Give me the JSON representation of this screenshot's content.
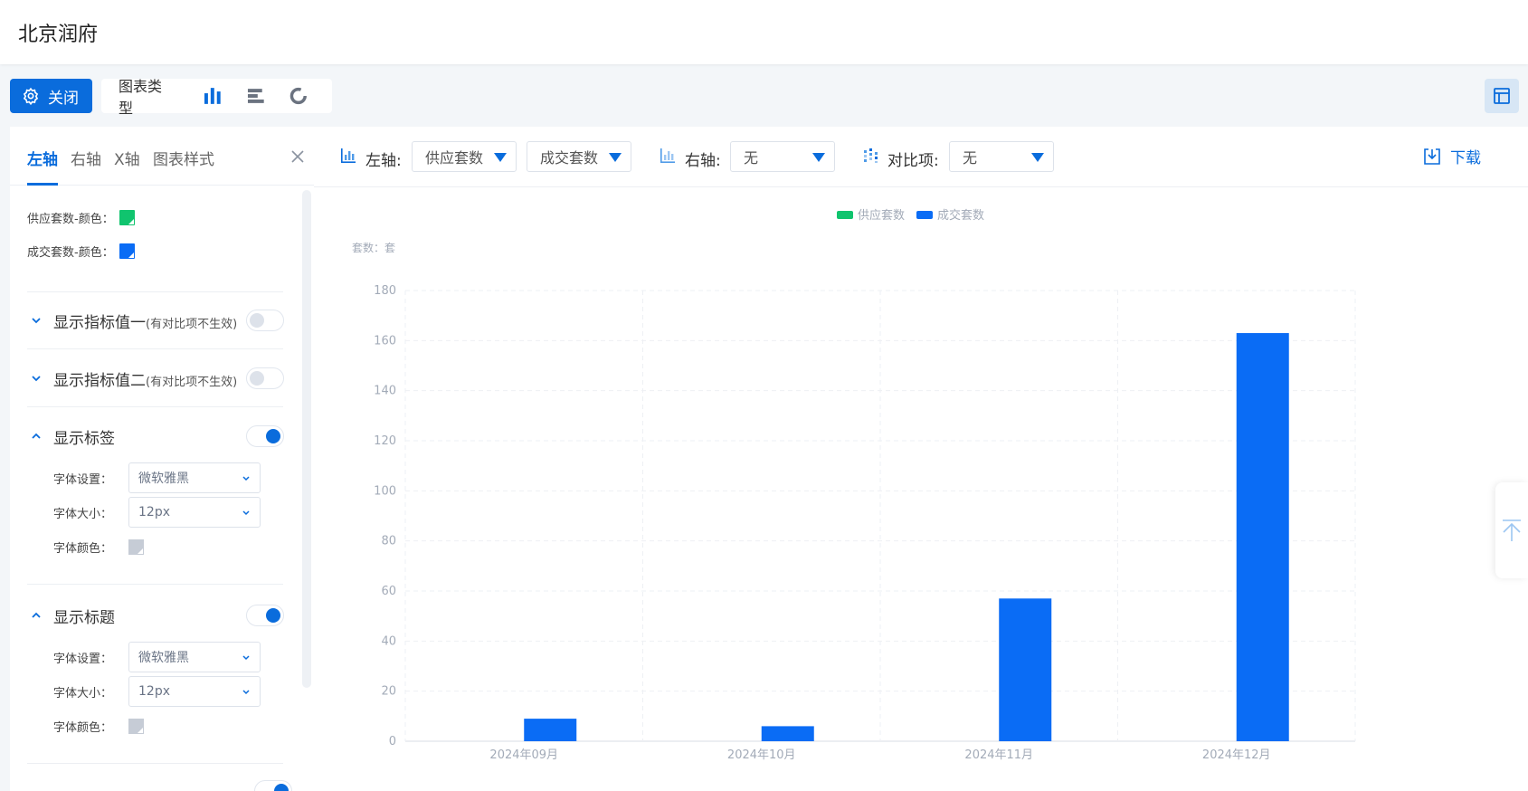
{
  "app": {
    "title": "北京润府"
  },
  "toolbar": {
    "close_label": "关闭",
    "chart_type_label": "图表类型"
  },
  "panel": {
    "tabs": [
      "左轴",
      "右轴",
      "X轴",
      "图表样式"
    ],
    "active_tab": 0,
    "colors": [
      {
        "label": "供应套数-颜色：",
        "color": "#10c46e"
      },
      {
        "label": "成交套数-颜色：",
        "color": "#0a6cf5"
      }
    ],
    "sections": {
      "metric1": {
        "title": "显示指标值一",
        "note": "(有对比项不生效)",
        "enabled": false,
        "expanded": false
      },
      "metric2": {
        "title": "显示指标值二",
        "note": "(有对比项不生效)",
        "enabled": false,
        "expanded": false
      },
      "labels": {
        "title": "显示标签",
        "enabled": true,
        "expanded": true,
        "font_label": "字体设置：",
        "font_value": "微软雅黑",
        "size_label": "字体大小：",
        "size_value": "12px",
        "color_label": "字体颜色："
      },
      "titles": {
        "title": "显示标题",
        "enabled": true,
        "expanded": true,
        "font_label": "字体设置：",
        "font_value": "微软雅黑",
        "size_label": "字体大小：",
        "size_value": "12px",
        "color_label": "字体颜色："
      }
    }
  },
  "axisbar": {
    "left_label": "左轴:",
    "left_values": [
      "供应套数",
      "成交套数"
    ],
    "right_label": "右轴:",
    "right_value": "无",
    "compare_label": "对比项:",
    "compare_value": "无",
    "download_label": "下载"
  },
  "chart_data": {
    "type": "bar",
    "categories": [
      "2024年09月",
      "2024年10月",
      "2024年11月",
      "2024年12月"
    ],
    "series": [
      {
        "name": "供应套数",
        "color": "#10c46e",
        "values": [
          0,
          0,
          0,
          0
        ]
      },
      {
        "name": "成交套数",
        "color": "#0a6cf5",
        "values": [
          9,
          6,
          57,
          163
        ]
      }
    ],
    "ylabel": "套数：套",
    "ylim": [
      0,
      180
    ],
    "yticks": [
      0,
      20,
      40,
      60,
      80,
      100,
      120,
      140,
      160,
      180
    ],
    "grid": true,
    "legend": "top-center"
  }
}
